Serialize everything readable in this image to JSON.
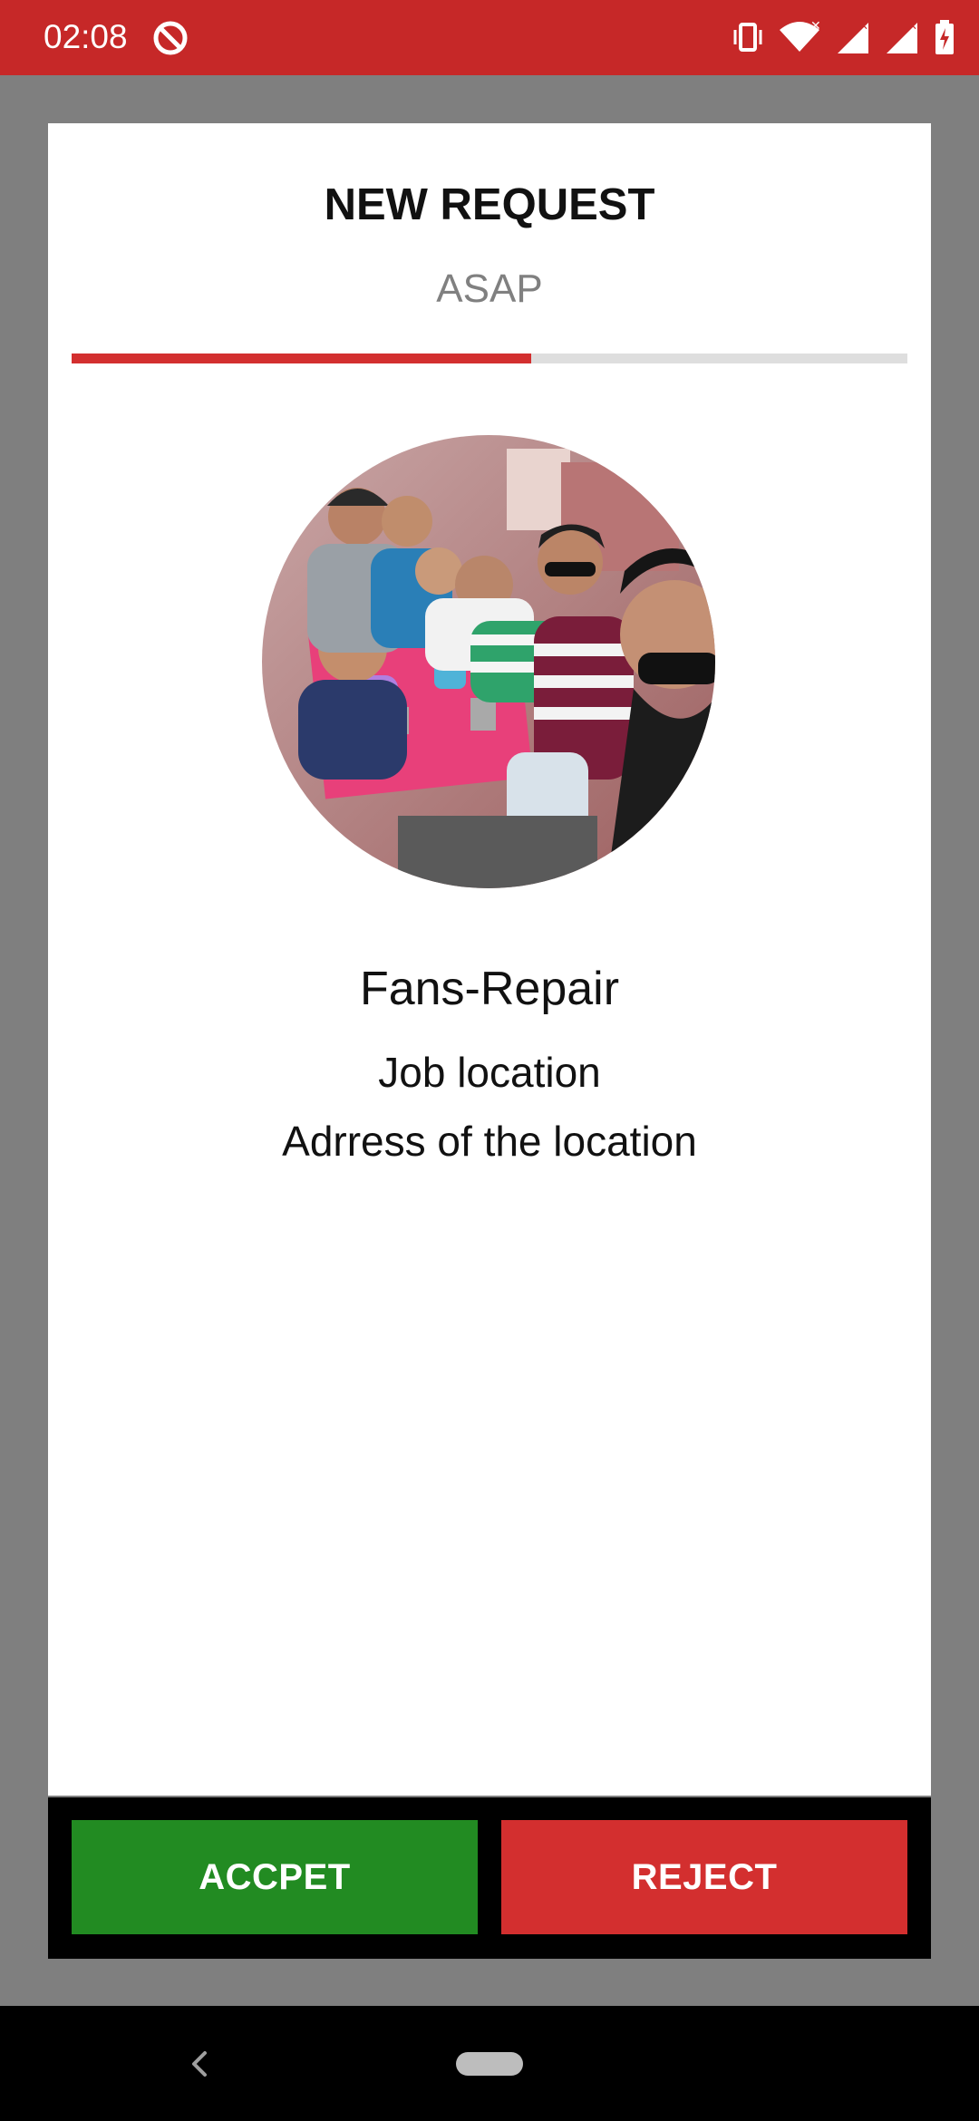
{
  "status_bar": {
    "time": "02:08",
    "color": "#c62828",
    "icons": [
      "app-notification-icon",
      "vibrate-icon",
      "wifi-icon",
      "signal-icon",
      "signal-icon",
      "battery-charging-icon"
    ]
  },
  "dialog": {
    "title": "NEW REQUEST",
    "subtitle": "ASAP",
    "progress_percent": 55,
    "avatar_icon": "group-photo-avatar",
    "service_name": "Fans-Repair",
    "job_location": "Job location",
    "job_address": "Adrress of the location"
  },
  "actions": {
    "accept_label": "ACCPET",
    "reject_label": "REJECT",
    "accept_color": "#228b22",
    "reject_color": "#d32f2f"
  },
  "navigation": {
    "icons": [
      "back-icon",
      "home-pill-icon"
    ]
  }
}
